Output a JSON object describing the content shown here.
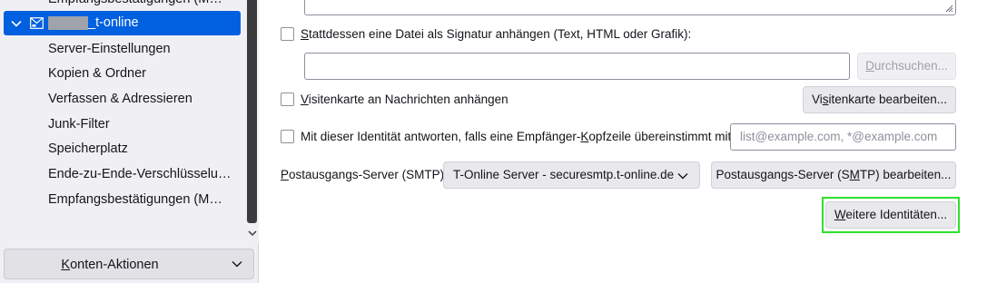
{
  "sidebar": {
    "partial_item": "Empfangsbestätigungen (M…",
    "account": {
      "name": "_t-online",
      "icon": "mail-account-icon"
    },
    "items": [
      {
        "label": "Server-Einstellungen"
      },
      {
        "label": "Kopien & Ordner"
      },
      {
        "label": "Verfassen & Adressieren"
      },
      {
        "label": "Junk-Filter"
      },
      {
        "label": "Speicherplatz"
      },
      {
        "label": "Ende-zu-Ende-Verschlüsselu…"
      },
      {
        "label": "Empfangsbestätigungen (M…"
      }
    ],
    "account_actions": {
      "pre": "",
      "key": "K",
      "post": "onten-Aktionen"
    }
  },
  "main": {
    "attach_signature": {
      "pre": "",
      "key": "S",
      "post": "tattdessen eine Datei als Signatur anhängen (Text, HTML oder Grafik):"
    },
    "browse_button": {
      "pre": "",
      "key": "D",
      "post": "urchsuchen..."
    },
    "vcard": {
      "pre": "",
      "key": "V",
      "post": "isitenkarte an Nachrichten anhängen"
    },
    "vcard_edit_button": {
      "pre": "Vi",
      "key": "s",
      "post": "itenkarte bearbeiten..."
    },
    "reply_identity": {
      "pre": "Mit dieser Identität antworten, falls eine Empfänger-",
      "key": "K",
      "post": "opfzeile übereinstimmt mit:"
    },
    "reply_identity_placeholder": "list@example.com, *@example.com",
    "smtp_label": {
      "pre": "",
      "key": "P",
      "post": "ostausgangs-Server (SMTP):"
    },
    "smtp_selected": "T-Online Server - securesmtp.t-online.de",
    "smtp_edit_button": {
      "pre": "Postausgangs-Server (S",
      "key": "M",
      "post": "TP) bearbeiten..."
    },
    "more_identities_button": {
      "pre": "",
      "key": "W",
      "post": "eitere Identitäten..."
    }
  },
  "colors": {
    "accent": "#0060df",
    "focus_highlight": "#2ee02e",
    "scrollbar_thumb": "#3b3b3e"
  }
}
